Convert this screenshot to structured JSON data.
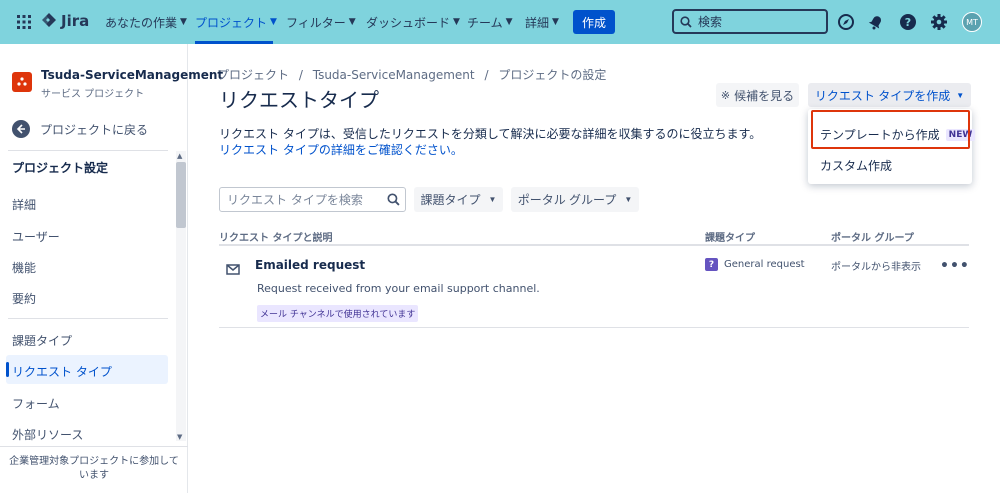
{
  "topnav": {
    "logo": "Jira",
    "items": [
      {
        "label": "あなたの作業"
      },
      {
        "label": "プロジェクト"
      },
      {
        "label": "フィルター"
      },
      {
        "label": "ダッシュボード"
      },
      {
        "label": "チーム"
      },
      {
        "label": "詳細"
      }
    ],
    "create_label": "作成",
    "search_placeholder": "検索",
    "avatar_initials": "MT",
    "colors": {
      "bar": "#7fd3dd",
      "primary": "#0052cc"
    }
  },
  "sidebar": {
    "project_name": "Tsuda-ServiceManagement",
    "project_type": "サービス プロジェクト",
    "back_label": "プロジェクトに戻る",
    "section_title": "プロジェクト設定",
    "items": [
      {
        "label": "詳細"
      },
      {
        "label": "ユーザー"
      },
      {
        "label": "機能"
      },
      {
        "label": "要約"
      },
      {
        "label": "課題タイプ"
      },
      {
        "label": "リクエスト タイプ"
      },
      {
        "label": "フォーム"
      },
      {
        "label": "外部リソース"
      }
    ],
    "footer": "企業管理対象プロジェクトに参加しています"
  },
  "main": {
    "breadcrumb": [
      "プロジェクト",
      "/",
      "Tsuda-ServiceManagement",
      "/",
      "プロジェクトの設定"
    ],
    "title": "リクエストタイプ",
    "suggest_button": "候補を見る",
    "create_type_button": "リクエスト タイプを作成",
    "description": "リクエスト タイプは、受信したリクエストを分類して解決に必要な詳細を収集するのに役立ちます。",
    "description_link": "リクエスト タイプの詳細をご確認ください。",
    "dropdown": {
      "from_template": "テンプレートから作成",
      "new_badge": "NEW",
      "custom": "カスタム作成"
    },
    "filters": {
      "search_placeholder": "リクエスト タイプを検索",
      "issue_type": "課題タイプ",
      "portal_group": "ポータル グループ"
    },
    "table": {
      "headers": [
        "リクエスト タイプと説明",
        "課題タイプ",
        "ポータル グループ"
      ],
      "rows": [
        {
          "name": "Emailed request",
          "description": "Request received from your email support channel.",
          "lozenge": "メール チャンネルで使用されています",
          "issue_type": "General request",
          "portal_group": "ポータルから非表示"
        }
      ]
    }
  }
}
